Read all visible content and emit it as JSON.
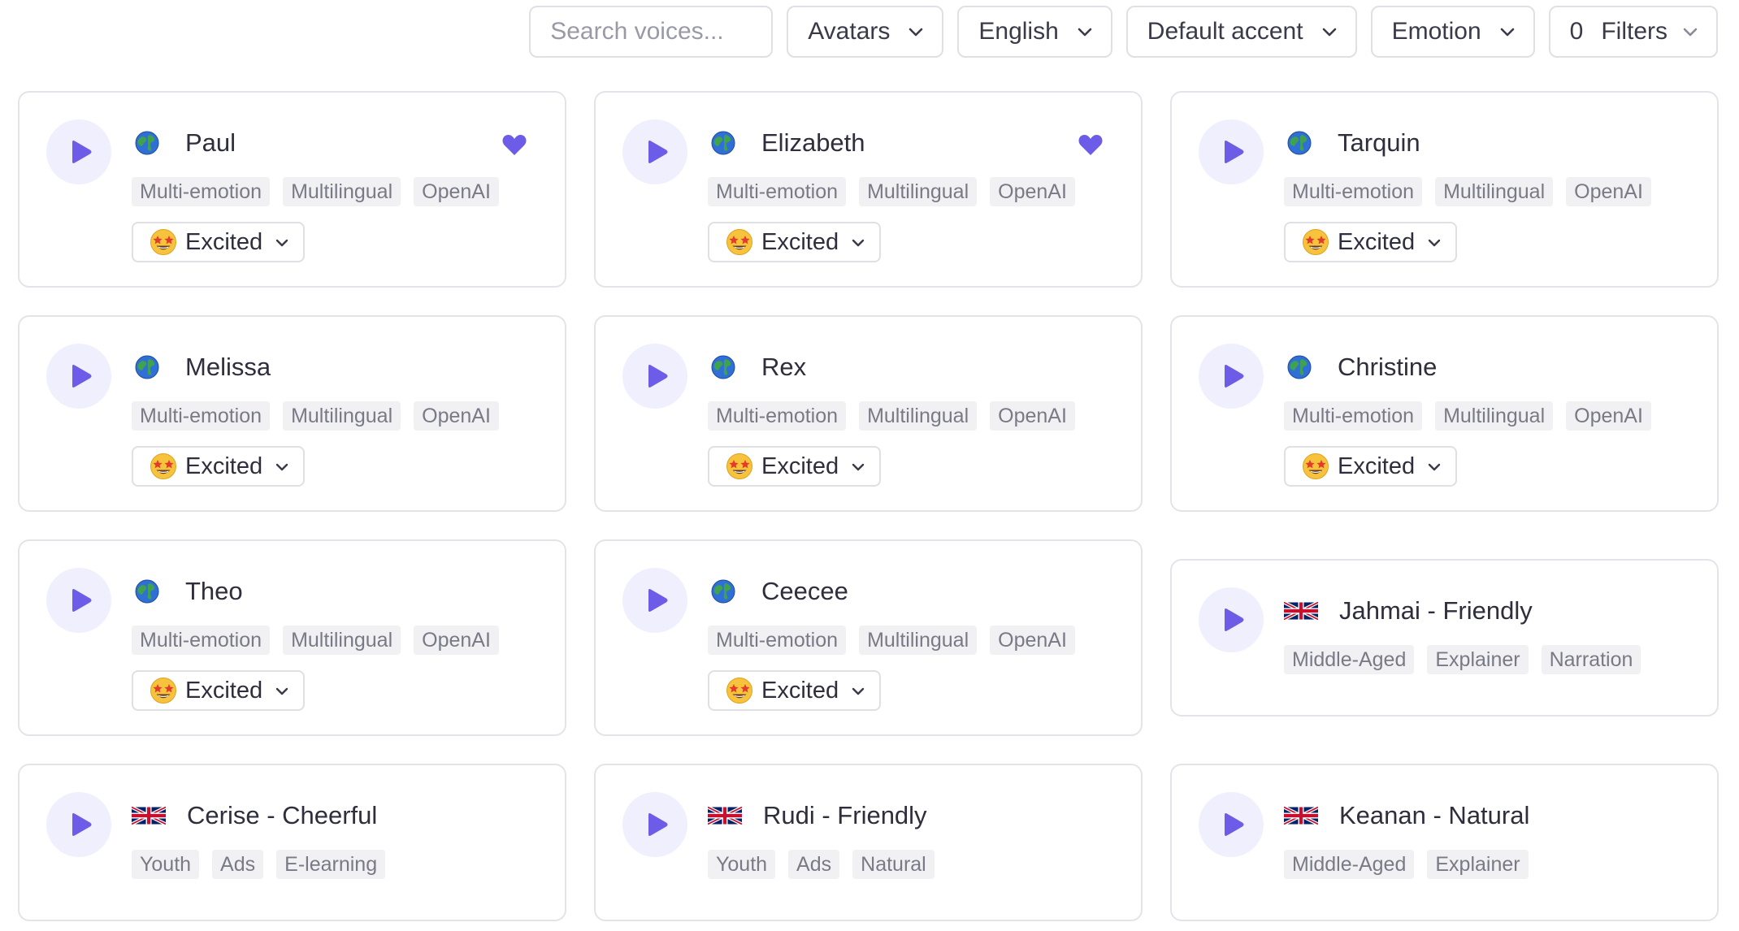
{
  "toolbar": {
    "search_placeholder": "Search voices...",
    "avatars": "Avatars",
    "language": "English",
    "accent": "Default accent",
    "emotion": "Emotion",
    "filters_count": "0",
    "filters": "Filters"
  },
  "colors": {
    "accent": "#6c5ce7",
    "play_bg": "#f0effd",
    "tag_bg": "#f1f1f4"
  },
  "cards": [
    {
      "name": "Paul",
      "icon": "globe-icon",
      "favorite": true,
      "tags": [
        "Multi-emotion",
        "Multilingual",
        "OpenAI"
      ],
      "emotion": "Excited"
    },
    {
      "name": "Elizabeth",
      "icon": "globe-icon",
      "favorite": true,
      "tags": [
        "Multi-emotion",
        "Multilingual",
        "OpenAI"
      ],
      "emotion": "Excited"
    },
    {
      "name": "Tarquin",
      "icon": "globe-icon",
      "favorite": false,
      "tags": [
        "Multi-emotion",
        "Multilingual",
        "OpenAI"
      ],
      "emotion": "Excited"
    },
    {
      "name": "Melissa",
      "icon": "globe-icon",
      "favorite": false,
      "tags": [
        "Multi-emotion",
        "Multilingual",
        "OpenAI"
      ],
      "emotion": "Excited"
    },
    {
      "name": "Rex",
      "icon": "globe-icon",
      "favorite": false,
      "tags": [
        "Multi-emotion",
        "Multilingual",
        "OpenAI"
      ],
      "emotion": "Excited"
    },
    {
      "name": "Christine",
      "icon": "globe-icon",
      "favorite": false,
      "tags": [
        "Multi-emotion",
        "Multilingual",
        "OpenAI"
      ],
      "emotion": "Excited"
    },
    {
      "name": "Theo",
      "icon": "globe-icon",
      "favorite": false,
      "tags": [
        "Multi-emotion",
        "Multilingual",
        "OpenAI"
      ],
      "emotion": "Excited"
    },
    {
      "name": "Ceecee",
      "icon": "globe-icon",
      "favorite": false,
      "tags": [
        "Multi-emotion",
        "Multilingual",
        "OpenAI"
      ],
      "emotion": "Excited"
    },
    {
      "name": "Jahmai - Friendly",
      "icon": "uk-flag-icon",
      "favorite": false,
      "tags": [
        "Middle-Aged",
        "Explainer",
        "Narration"
      ],
      "emotion": null
    },
    {
      "name": "Cerise - Cheerful",
      "icon": "uk-flag-icon",
      "favorite": false,
      "tags": [
        "Youth",
        "Ads",
        "E-learning"
      ],
      "emotion": null
    },
    {
      "name": "Rudi - Friendly",
      "icon": "uk-flag-icon",
      "favorite": false,
      "tags": [
        "Youth",
        "Ads",
        "Natural"
      ],
      "emotion": null
    },
    {
      "name": "Keanan - Natural",
      "icon": "uk-flag-icon",
      "favorite": false,
      "tags": [
        "Middle-Aged",
        "Explainer"
      ],
      "emotion": null
    }
  ]
}
